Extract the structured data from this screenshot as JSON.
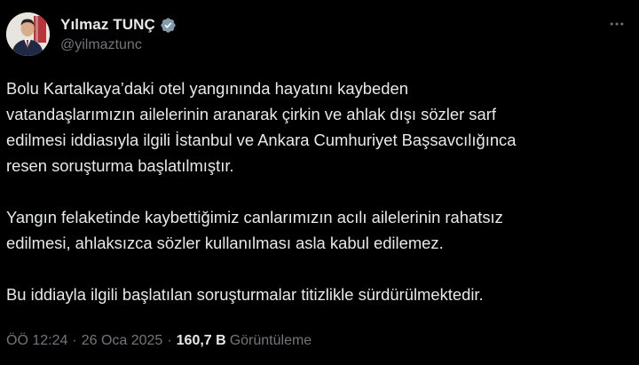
{
  "author": {
    "display_name": "Yılmaz TUNÇ",
    "handle": "@yilmaztunc",
    "verified_badge_color": "#829aab",
    "avatar_icon": "profile-photo"
  },
  "tweet": {
    "paragraphs": [
      "Bolu Kartalkaya’daki otel yangınında hayatını kaybeden\nvatandaşlarımızın ailelerinin aranarak çirkin ve ahlak dışı sözler sarf\nedilmesi iddiasıyla ilgili İstanbul ve Ankara Cumhuriyet Başsavcılığınca\nresen soruşturma başlatılmıştır.",
      "Yangın felaketinde kaybettiğimiz canlarımızın acılı ailelerinin rahatsız\nedilmesi, ahlaksızca sözler kullanılması asla kabul edilemez.",
      "Bu iddiayla ilgili başlatılan soruşturmalar titizlikle sürdürülmektedir."
    ]
  },
  "meta": {
    "time": "ÖÖ 12:24",
    "separator1": "·",
    "date": "26 Oca 2025",
    "separator2": "·",
    "views_count": "160,7 B",
    "views_label": "Görüntüleme"
  },
  "colors": {
    "background": "#000000",
    "text_primary": "#e7e9ea",
    "text_secondary": "#71767b"
  },
  "icons": {
    "more": "more-options-icon",
    "verified": "verified-badge-icon"
  }
}
